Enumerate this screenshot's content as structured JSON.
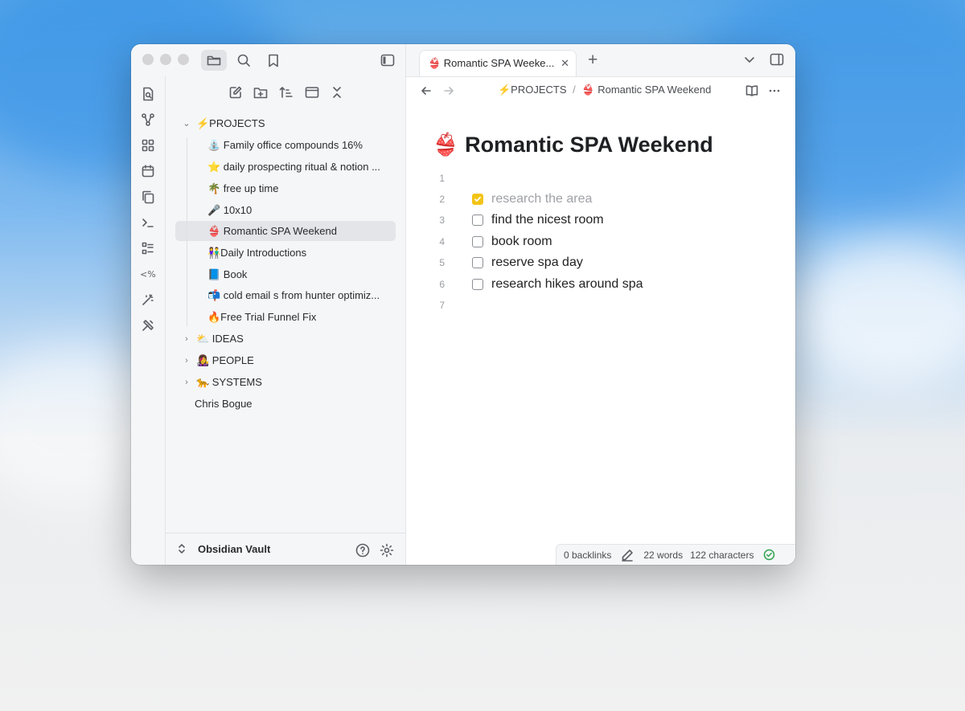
{
  "colors": {
    "accent_check": "#f2c417",
    "sidebar_bg": "#f5f6f8",
    "selected_bg": "#e4e5e9"
  },
  "tab": {
    "title": "👙 Romantic SPA Weeke...",
    "close": "✕",
    "new": "+"
  },
  "breadcrumb": {
    "folder": "⚡PROJECTS",
    "sep": "/",
    "note": "👙 Romantic SPA Weekend"
  },
  "tree": {
    "root_folder": "⚡PROJECTS",
    "children": [
      "⛲ Family office compounds 16%",
      "⭐ daily prospecting ritual & notion ...",
      "🌴 free up time",
      "🎤 10x10",
      "👙 Romantic SPA Weekend",
      "👫Daily Introductions",
      "📘 Book",
      "📬 cold email s from hunter optimiz...",
      "🔥Free Trial Funnel Fix"
    ],
    "folders": [
      "⛅ IDEAS",
      "👩‍🎤 PEOPLE",
      "🐆 SYSTEMS"
    ],
    "file": "Chris Bogue"
  },
  "vault": {
    "name": "Obsidian Vault"
  },
  "note": {
    "title": "👙 Romantic SPA Weekend",
    "line_numbers": [
      "1",
      "2",
      "3",
      "4",
      "5",
      "6",
      "7"
    ],
    "tasks": [
      {
        "text": "research the area",
        "checked": true
      },
      {
        "text": "find the nicest room",
        "checked": false
      },
      {
        "text": "book room",
        "checked": false
      },
      {
        "text": "reserve spa day",
        "checked": false
      },
      {
        "text": "research hikes around spa",
        "checked": false
      }
    ]
  },
  "status": {
    "backlinks": "0 backlinks",
    "words": "22 words",
    "characters": "122 characters"
  }
}
